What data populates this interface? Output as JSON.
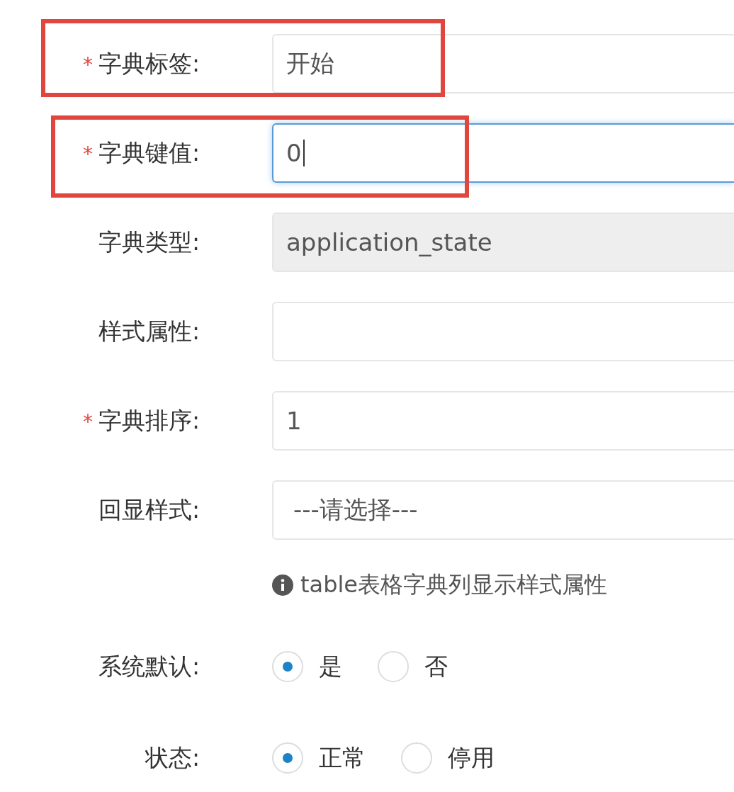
{
  "fields": [
    {
      "kind": "input",
      "marker": "*",
      "label": "字典标签:",
      "value": "开始",
      "highlighted": true
    },
    {
      "kind": "input",
      "marker": "*",
      "label": "字典键值:",
      "value": "0",
      "focused": true,
      "highlighted": true
    },
    {
      "kind": "input",
      "label": "字典类型:",
      "value": "application_state",
      "disabled": true
    },
    {
      "kind": "input",
      "label": "样式属性:"
    },
    {
      "kind": "input",
      "marker": "*",
      "label": "字典排序:",
      "value": "1"
    },
    {
      "kind": "select",
      "label": "回显样式:",
      "value": "---请选择---",
      "hint": "table表格字典列显示样式属性"
    },
    {
      "kind": "radio",
      "label": "系统默认:",
      "options": [
        {
          "label": "是",
          "selected": true
        },
        {
          "label": "否",
          "selected": false
        }
      ]
    },
    {
      "kind": "radio",
      "label": "状态:",
      "options": [
        {
          "label": "正常",
          "selected": true
        },
        {
          "label": "停用",
          "selected": false
        }
      ]
    }
  ]
}
